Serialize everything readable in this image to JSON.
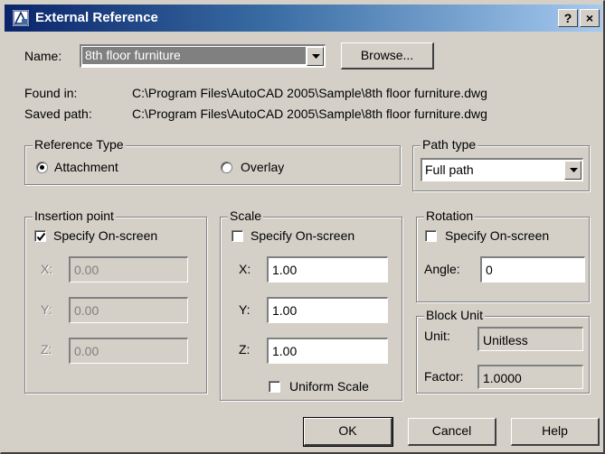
{
  "window": {
    "title": "External Reference",
    "help_button": "?",
    "close_button": "×"
  },
  "name_row": {
    "label": "Name:",
    "selected_value": "8th floor furniture",
    "browse_button": "Browse..."
  },
  "paths": {
    "found_in_label": "Found in:",
    "found_in_value": "C:\\Program Files\\AutoCAD 2005\\Sample\\8th floor furniture.dwg",
    "saved_path_label": "Saved path:",
    "saved_path_value": "C:\\Program Files\\AutoCAD 2005\\Sample\\8th floor furniture.dwg"
  },
  "reference_type": {
    "title": "Reference Type",
    "attachment_label": "Attachment",
    "attachment_selected": true,
    "overlay_label": "Overlay",
    "overlay_selected": false
  },
  "path_type": {
    "title": "Path type",
    "selected_value": "Full path"
  },
  "insertion_point": {
    "title": "Insertion point",
    "specify_label": "Specify On-screen",
    "specify_checked": true,
    "x_label": "X:",
    "x_value": "0.00",
    "y_label": "Y:",
    "y_value": "0.00",
    "z_label": "Z:",
    "z_value": "0.00"
  },
  "scale": {
    "title": "Scale",
    "specify_label": "Specify On-screen",
    "specify_checked": false,
    "x_label": "X:",
    "x_value": "1.00",
    "y_label": "Y:",
    "y_value": "1.00",
    "z_label": "Z:",
    "z_value": "1.00",
    "uniform_label": "Uniform Scale",
    "uniform_checked": false
  },
  "rotation": {
    "title": "Rotation",
    "specify_label": "Specify On-screen",
    "specify_checked": false,
    "angle_label": "Angle:",
    "angle_value": "0"
  },
  "block_unit": {
    "title": "Block Unit",
    "unit_label": "Unit:",
    "unit_value": "Unitless",
    "factor_label": "Factor:",
    "factor_value": "1.0000"
  },
  "buttons": {
    "ok": "OK",
    "cancel": "Cancel",
    "help": "Help"
  },
  "colors": {
    "dialog_bg": "#d4d0c8",
    "titlebar_start": "#0a246a",
    "titlebar_end": "#a6caf0",
    "selection": "#808080"
  }
}
